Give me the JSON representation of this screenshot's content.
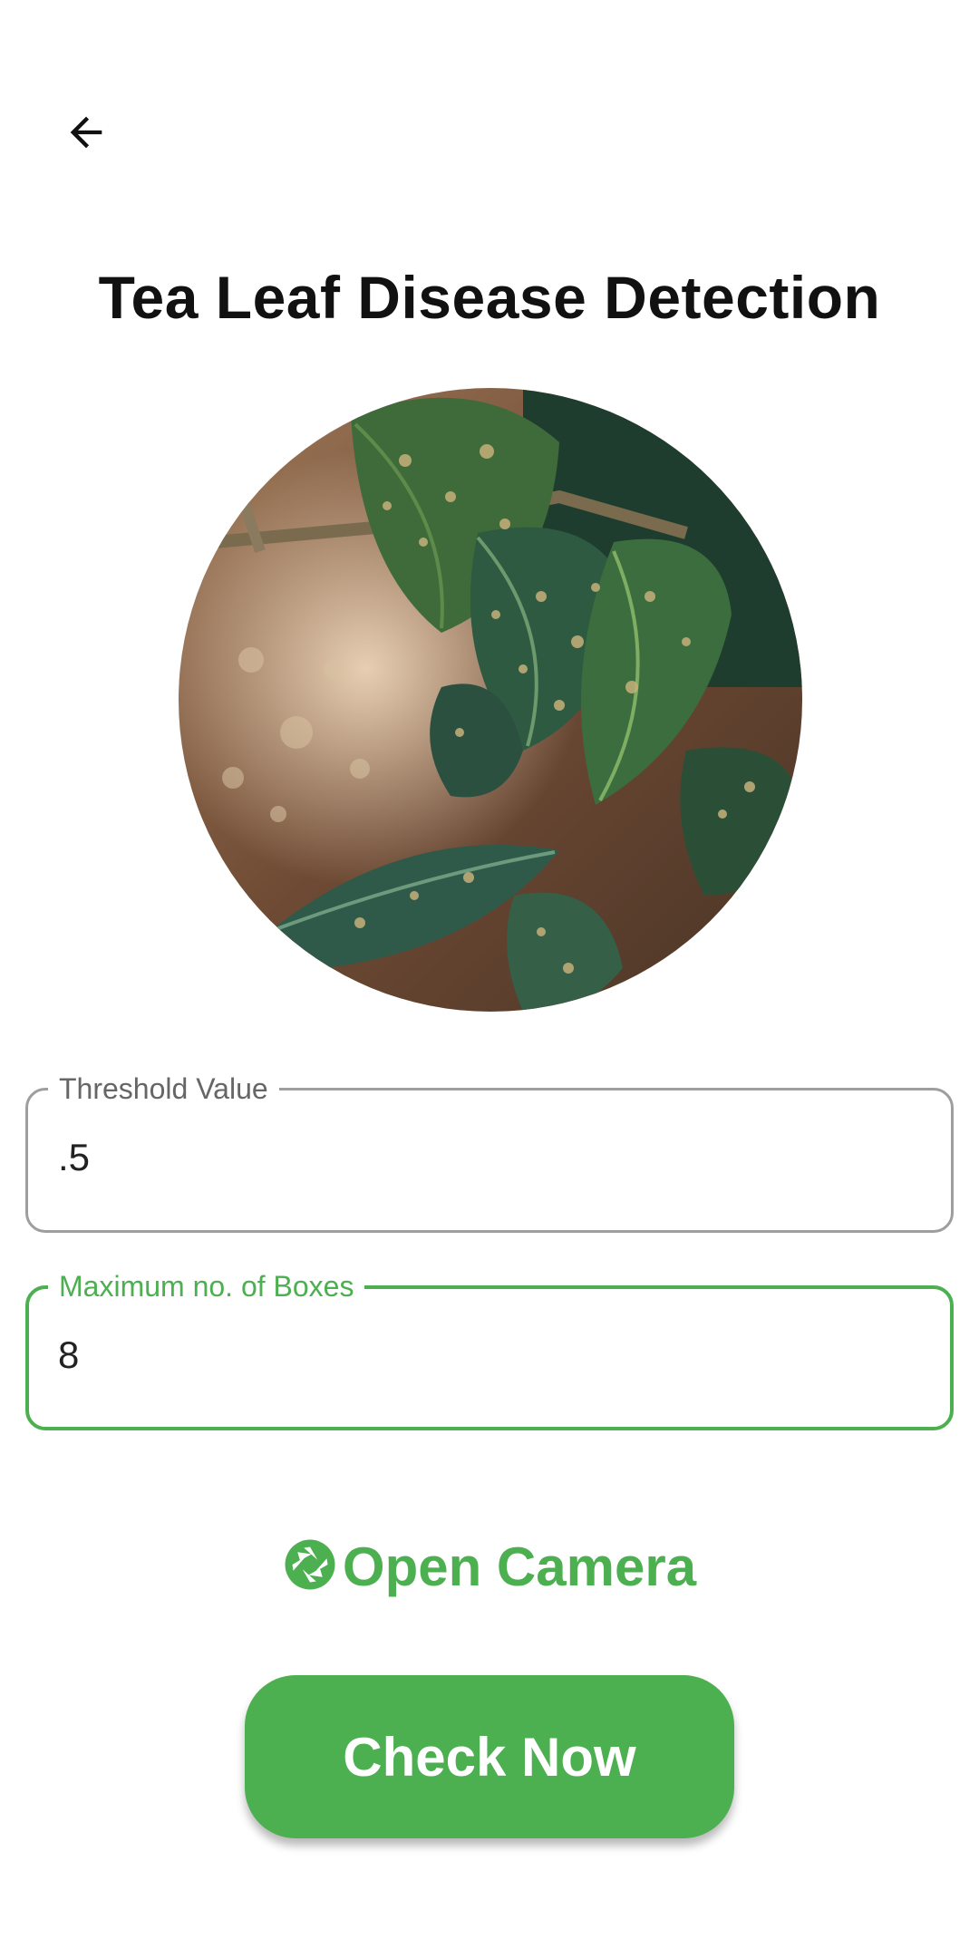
{
  "header": {
    "back_icon": "arrow-left-icon",
    "title": "Tea Leaf Disease Detection"
  },
  "preview_image": {
    "description_icon": "tea-leaf-photo"
  },
  "fields": {
    "threshold": {
      "label": "Threshold Value",
      "value": ".5"
    },
    "max_boxes": {
      "label": "Maximum no. of Boxes",
      "value": "8"
    }
  },
  "actions": {
    "camera_icon": "camera-shutter-icon",
    "open_camera_label": "Open Camera",
    "check_now_label": "Check Now"
  },
  "colors": {
    "accent": "#4caf50",
    "title": "#111111",
    "field_border_inactive": "#9e9e9e"
  }
}
